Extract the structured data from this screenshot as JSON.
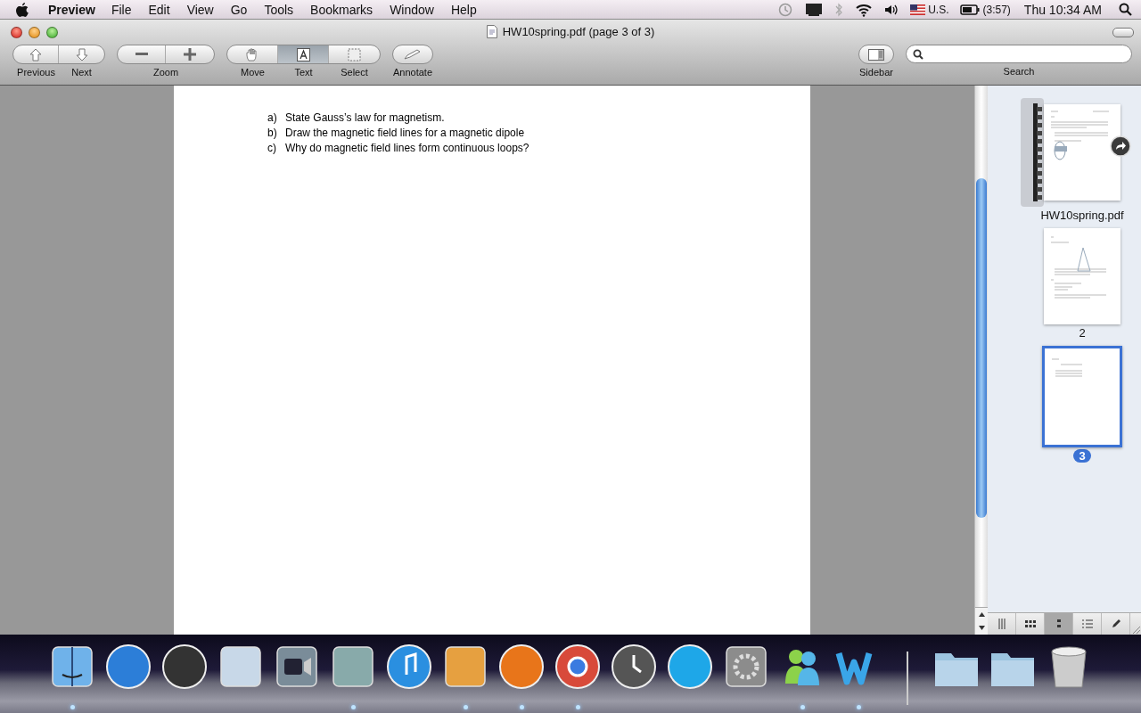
{
  "menubar": {
    "app_name": "Preview",
    "menus": [
      "File",
      "Edit",
      "View",
      "Go",
      "Tools",
      "Bookmarks",
      "Window",
      "Help"
    ],
    "input_source": "U.S.",
    "battery_time": "(3:57)",
    "clock": "Thu 10:34 AM"
  },
  "window": {
    "title": "HW10spring.pdf (page 3 of 3)",
    "toolbar_left": [
      {
        "kind": "segmented",
        "segments": [
          {
            "label": "Previous",
            "selected": false
          },
          {
            "label": "Next",
            "selected": false
          }
        ]
      },
      {
        "kind": "segmented",
        "label": "Zoom",
        "segments": [
          {
            "selected": false
          },
          {
            "selected": false
          }
        ]
      },
      {
        "kind": "segmented",
        "segments": [
          {
            "label": "Move",
            "selected": false
          },
          {
            "label": "Text",
            "selected": true
          },
          {
            "label": "Select",
            "selected": false
          }
        ]
      },
      {
        "kind": "button",
        "label": "Annotate"
      }
    ],
    "toolbar_right": [
      {
        "kind": "button",
        "label": "Sidebar"
      },
      {
        "kind": "search",
        "label": "Search"
      }
    ]
  },
  "document": {
    "items": [
      {
        "marker": "a)",
        "text": "State Gauss’s law for magnetism."
      },
      {
        "marker": "b)",
        "text": "Draw the magnetic field lines for a magnetic dipole"
      },
      {
        "marker": "c)",
        "text": "Why do magnetic field lines form continuous loops?"
      }
    ]
  },
  "sidebar": {
    "thumbnails": [
      {
        "kind": "cover",
        "caption": "HW10spring.pdf",
        "selected": false
      },
      {
        "kind": "page",
        "caption": "2",
        "selected": false
      },
      {
        "kind": "page",
        "caption": "3",
        "selected": true
      }
    ],
    "view_buttons": [
      {
        "selected": false
      },
      {
        "selected": false
      },
      {
        "selected": true
      },
      {
        "selected": false
      },
      {
        "selected": false
      }
    ]
  },
  "dock": {
    "apps": [
      {
        "running": true
      },
      {
        "running": false
      },
      {
        "running": false
      },
      {
        "running": false
      },
      {
        "running": false
      },
      {
        "running": true
      },
      {
        "running": false
      },
      {
        "running": true
      },
      {
        "running": true
      },
      {
        "running": true
      },
      {
        "running": false
      },
      {
        "running": false
      },
      {
        "running": false
      },
      {
        "running": true
      },
      {
        "running": true
      },
      {
        "running": false
      },
      {
        "running": false
      },
      {
        "running": false
      }
    ]
  }
}
